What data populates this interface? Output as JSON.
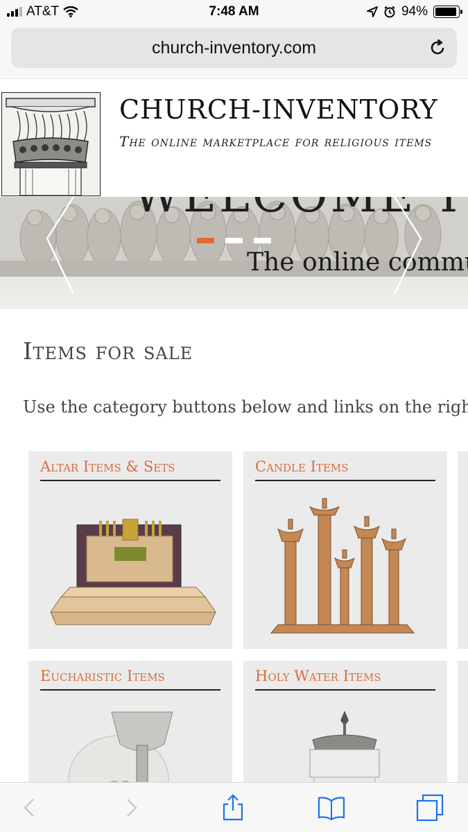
{
  "status": {
    "carrier": "AT&T",
    "time": "7:48 AM",
    "battery": "94%",
    "battery_level": 0.94,
    "icons": [
      "signal-icon",
      "wifi-icon",
      "location-icon",
      "alarm-icon",
      "battery-icon"
    ]
  },
  "browser": {
    "url": "church-inventory.com",
    "toolbar": [
      "back-icon",
      "forward-icon",
      "share-icon",
      "bookmarks-icon",
      "tabs-icon"
    ]
  },
  "header": {
    "title": "CHURCH-INVENTORY",
    "tagline": "The online marketplace for religious items"
  },
  "hero": {
    "headline": "WELCOME TO",
    "subtitle": "The online community",
    "slides_total": 3,
    "active_slide": 1
  },
  "content": {
    "section_title": "Items for sale",
    "intro": "Use the category buttons below and links on the right"
  },
  "categories": [
    {
      "title": "Altar Items & Sets"
    },
    {
      "title": "Candle Items"
    },
    {
      "title": "Eucharistic Items"
    },
    {
      "title": "Holy Water Items"
    }
  ],
  "colors": {
    "accent": "#d96d3c",
    "card_bg": "#ebebeb",
    "slider_active": "#e06a2f"
  }
}
